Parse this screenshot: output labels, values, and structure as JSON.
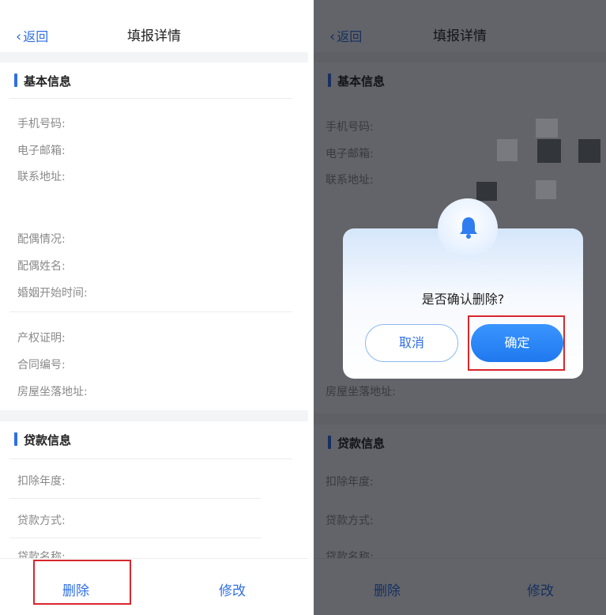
{
  "nav": {
    "back_label": "返回",
    "title": "填报详情"
  },
  "basic_section": {
    "title": "基本信息"
  },
  "basic_fields": {
    "phone": "手机号码:",
    "email": "电子邮箱:",
    "address": "联系地址:",
    "spouse_status": "配偶情况:",
    "spouse_name": "配偶姓名:",
    "marriage_start": "婚姻开始时间:",
    "property_cert": "产权证明:",
    "contract_no": "合同编号:",
    "house_address": "房屋坐落地址:"
  },
  "loan_section": {
    "title": "贷款信息"
  },
  "loan_fields": {
    "deduction_year": "扣除年度:",
    "loan_method": "贷款方式:",
    "loan_name": "贷款名称:"
  },
  "bottom_bar": {
    "delete_label": "删除",
    "modify_label": "修改"
  },
  "dialog": {
    "question": "是否确认删除?",
    "cancel_label": "取消",
    "confirm_label": "确定"
  },
  "colors": {
    "accent": "#2f6fe6",
    "highlight_box": "#d9262c",
    "confirm_button": "#1f79ee"
  },
  "icons": {
    "back": "chevron-left-icon",
    "dialog": "bell-icon"
  }
}
